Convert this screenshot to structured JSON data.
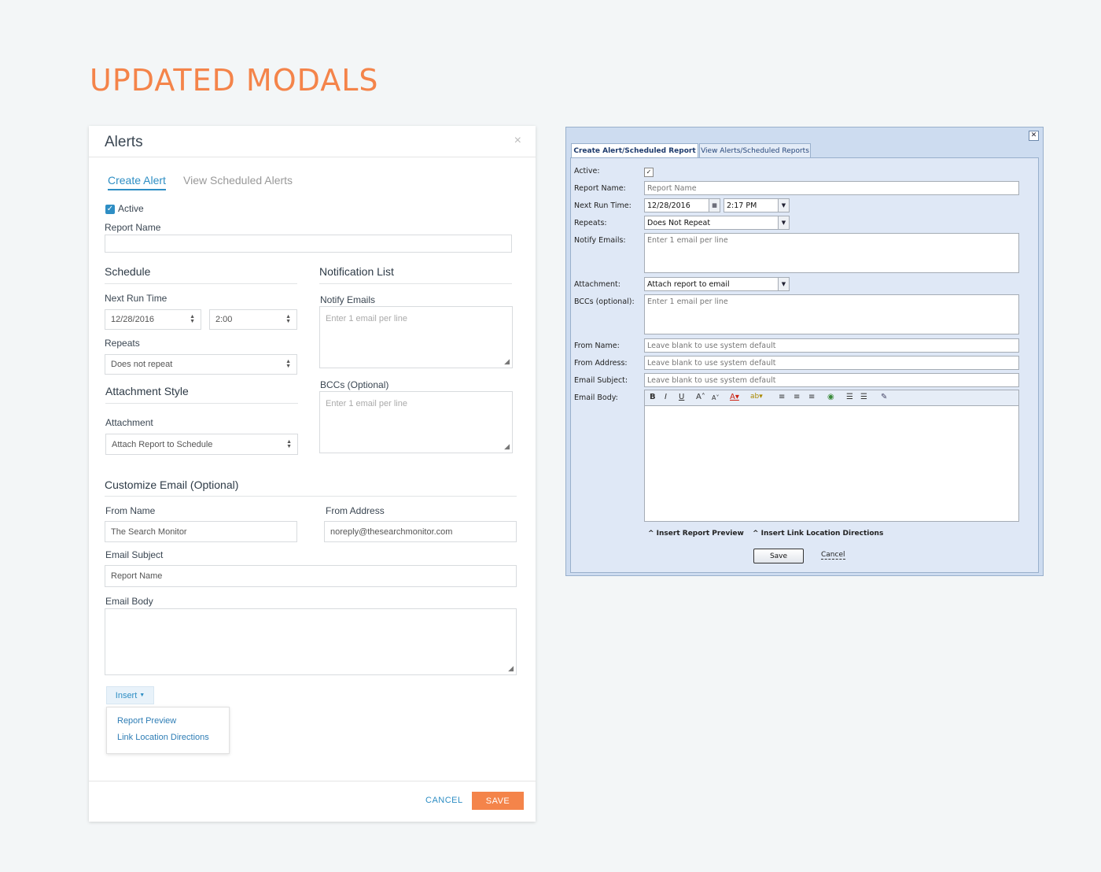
{
  "page": {
    "title": "UPDATED MODALS"
  },
  "new_modal": {
    "title": "Alerts",
    "close": "×",
    "tabs": [
      {
        "label": "Create Alert"
      },
      {
        "label": "View Scheduled Alerts"
      }
    ],
    "active_label": "Active",
    "report_name_label": "Report Name",
    "schedule": {
      "title": "Schedule",
      "next_run_label": "Next Run Time",
      "date": "12/28/2016",
      "time": "2:00",
      "repeats_label": "Repeats",
      "repeats_value": "Does not repeat"
    },
    "attachment": {
      "title": "Attachment Style",
      "label": "Attachment",
      "value": "Attach Report to Schedule"
    },
    "notification": {
      "title": "Notification List",
      "notify_label": "Notify Emails",
      "notify_placeholder": "Enter 1 email per line",
      "bcc_label": "BCCs (Optional)",
      "bcc_placeholder": "Enter 1 email per line"
    },
    "email": {
      "title": "Customize Email (Optional)",
      "from_name_label": "From Name",
      "from_name_value": "The Search Monitor",
      "from_address_label": "From Address",
      "from_address_value": "noreply@thesearchmonitor.com",
      "subject_label": "Email Subject",
      "subject_value": "Report Name",
      "body_label": "Email Body"
    },
    "insert": {
      "label": "Insert",
      "items": [
        {
          "label": "Report Preview"
        },
        {
          "label": "Link Location Directions"
        }
      ]
    },
    "footer": {
      "cancel": "CANCEL",
      "save": "SAVE"
    }
  },
  "old_modal": {
    "close": "✕",
    "tabs": [
      {
        "label": "Create Alert/Scheduled Report"
      },
      {
        "label": "View Alerts/Scheduled Reports"
      }
    ],
    "labels": {
      "active": "Active:",
      "report_name": "Report Name:",
      "next_run": "Next Run Time:",
      "repeats": "Repeats:",
      "notify": "Notify Emails:",
      "attachment": "Attachment:",
      "bccs": "BCCs (optional):",
      "from_name": "From Name:",
      "from_address": "From Address:",
      "email_subject": "Email Subject:",
      "email_body": "Email Body:"
    },
    "values": {
      "report_name": "Report Name",
      "date": "12/28/2016",
      "time": "2:17 PM",
      "repeats": "Does Not Repeat",
      "notify": "Enter 1 email per line",
      "attachment": "Attach report to email",
      "bccs": "Enter 1 email per line",
      "from_name": "Leave blank to use system default",
      "from_address": "Leave blank to use system default",
      "email_subject": "Leave blank to use system default"
    },
    "links": {
      "insert_preview": "^ Insert Report Preview",
      "insert_directions": "^ Insert Link Location Directions"
    },
    "buttons": {
      "save": "Save",
      "cancel": "Cancel"
    }
  }
}
